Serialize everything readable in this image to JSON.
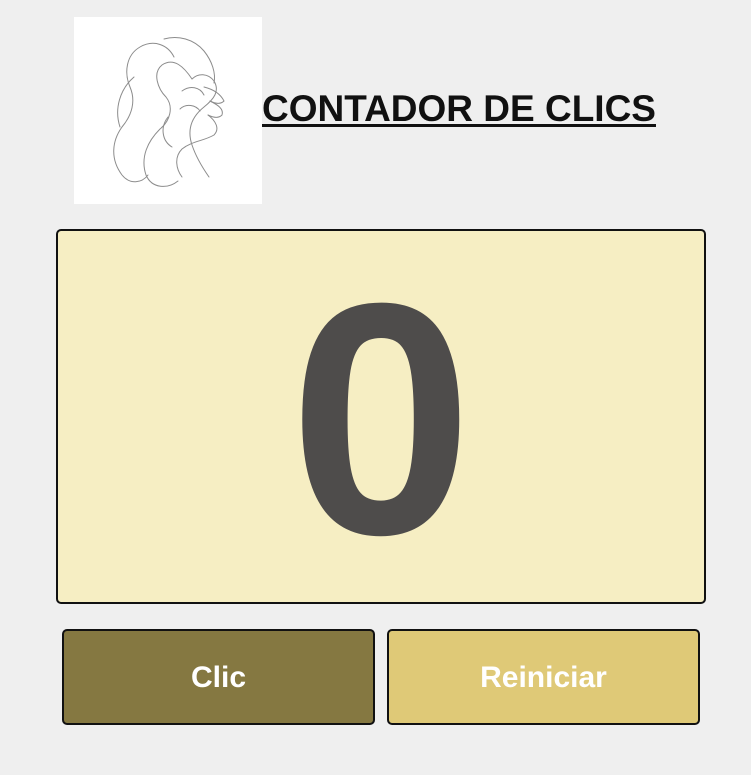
{
  "header": {
    "logo_icon": "line-art-face-icon",
    "title": "CONTADOR DE CLICS"
  },
  "counter": {
    "value": "0",
    "background_color": "#f6eec3",
    "text_color": "#4e4c4b"
  },
  "buttons": {
    "click_label": "Clic",
    "click_color": "#857841",
    "reset_label": "Reiniciar",
    "reset_color": "#dfc977"
  },
  "colors": {
    "page_background": "#efefef"
  }
}
